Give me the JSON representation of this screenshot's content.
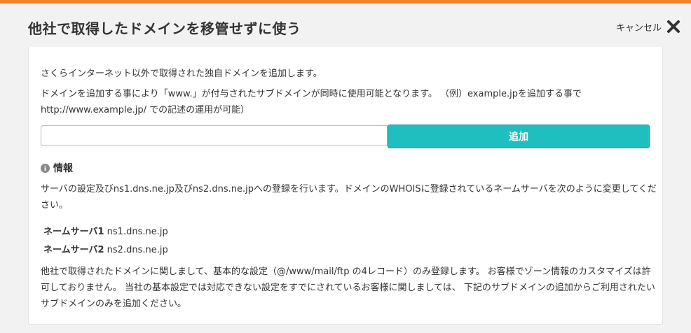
{
  "header": {
    "title": "他社で取得したドメインを移管せずに使う",
    "cancel_label": "キャンセル"
  },
  "main": {
    "intro": "さくらインターネット以外で取得された独自ドメインを追加します。",
    "note": "ドメインを追加する事により「www.」が付与されたサブドメインが同時に使用可能となります。 （例）example.jpを追加する事で http://www.example.jp/ での記述の運用が可能）",
    "domain_input": {
      "value": "",
      "placeholder": ""
    },
    "add_button_label": "追加",
    "info": {
      "heading": "情報",
      "text": "サーバの設定及びns1.dns.ne.jp及びns2.dns.ne.jpへの登録を行います。ドメインのWHOISに登録されているネームサーバを次のように変更してください。",
      "nameservers": [
        {
          "label": "ネームサーバ1",
          "value": "ns1.dns.ne.jp"
        },
        {
          "label": "ネームサーバ2",
          "value": "ns2.dns.ne.jp"
        }
      ],
      "footer": "他社で取得されたドメインに関しまして、基本的な設定（@/www/mail/ftp の4レコード）のみ登録します。 お客様でゾーン情報のカスタマイズは許可しておりません。 当社の基本設定では対応できない設定をすでにされているお客様に関しましては、 下記のサブドメインの追加からご利用されたいサブドメインのみを追加ください。"
    }
  },
  "colors": {
    "accent_top": "#f0832a",
    "button": "#1fbfbf"
  },
  "icons": {
    "close": "close-icon",
    "info": "info-icon"
  }
}
